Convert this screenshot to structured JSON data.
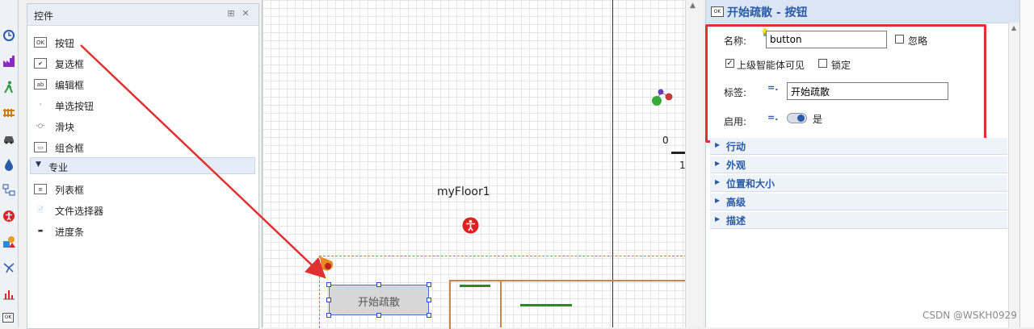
{
  "palette": {
    "title": "控件",
    "items": [
      {
        "label": "按钮",
        "icon": "button-icon",
        "glyph": "OK"
      },
      {
        "label": "复选框",
        "icon": "checkbox-icon",
        "glyph": "✔"
      },
      {
        "label": "编辑框",
        "icon": "edit-box-icon",
        "glyph": "ab"
      },
      {
        "label": "单选按钮",
        "icon": "radio-button-icon",
        "glyph": "◦"
      },
      {
        "label": "滑块",
        "icon": "slider-icon",
        "glyph": "-○-"
      },
      {
        "label": "组合框",
        "icon": "combo-box-icon",
        "glyph": "▭"
      }
    ],
    "section_label": "专业",
    "section_items": [
      {
        "label": "列表框",
        "icon": "list-box-icon",
        "glyph": "≡"
      },
      {
        "label": "文件选择器",
        "icon": "file-chooser-icon",
        "glyph": "📄"
      },
      {
        "label": "进度条",
        "icon": "progress-bar-icon",
        "glyph": "▬"
      }
    ]
  },
  "canvas": {
    "floor_label": "myFloor1",
    "button_label": "开始疏散",
    "axis_zero": "0",
    "axis_one": "1"
  },
  "properties": {
    "title": "开始疏散 - 按钮",
    "name_label": "名称:",
    "name_value": "button",
    "ignore_label": "忽略",
    "visible_label": "上级智能体可见",
    "lock_label": "锁定",
    "tag_label": "标签:",
    "tag_value": "开始疏散",
    "enable_label": "启用:",
    "enable_value": "是",
    "sections": [
      "行动",
      "外观",
      "位置和大小",
      "高级",
      "描述"
    ]
  },
  "watermark": "CSDN @WSKH0929",
  "colors": {
    "annotation_red": "#e03030",
    "accent_blue": "#2a5aa8"
  }
}
